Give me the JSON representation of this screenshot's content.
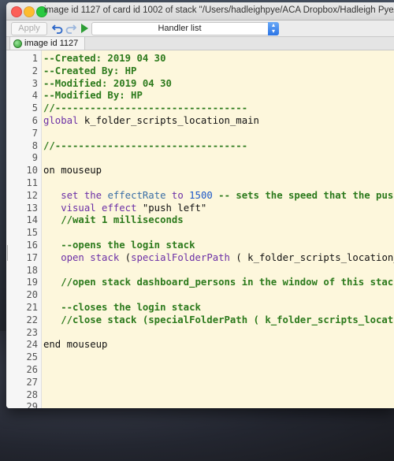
{
  "window": {
    "title": "image id 1127 of card id 1002 of stack \"/Users/hadleighpye/ACA Dropbox/Hadleigh Pye/[_] Beefficient"
  },
  "toolbar": {
    "apply_label": "Apply",
    "undo_icon": "undo-arrow-icon",
    "redo_icon": "redo-arrow-icon",
    "run_icon": "play-icon",
    "handler_select_value": "Handler list"
  },
  "tab": {
    "label": "image id 1127",
    "status_color": "#2e9e2e"
  },
  "colors": {
    "editor_background": "#fdf7dc",
    "comment": "#2c7a1c",
    "command": "#6b2fa6",
    "property": "#3a6ea5",
    "number": "#1a56c8"
  },
  "editor": {
    "lines": [
      {
        "n": "1",
        "segs": [
          {
            "t": "--Created: 2019 04 30",
            "k": "comment"
          }
        ]
      },
      {
        "n": "2",
        "segs": [
          {
            "t": "--Created By: HP",
            "k": "comment"
          }
        ]
      },
      {
        "n": "3",
        "segs": [
          {
            "t": "--Modified: 2019 04 30",
            "k": "comment"
          }
        ]
      },
      {
        "n": "4",
        "segs": [
          {
            "t": "--Modified By: HP",
            "k": "comment"
          }
        ]
      },
      {
        "n": "5",
        "segs": [
          {
            "t": "//---------------------------------",
            "k": "comment"
          }
        ]
      },
      {
        "n": "6",
        "segs": [
          {
            "t": "global",
            "k": "cmd"
          },
          {
            "t": " k_folder_scripts_location_main",
            "k": "pl"
          }
        ]
      },
      {
        "n": "7",
        "segs": []
      },
      {
        "n": "8",
        "segs": [
          {
            "t": "//---------------------------------",
            "k": "comment"
          }
        ]
      },
      {
        "n": "9",
        "segs": []
      },
      {
        "n": "10",
        "segs": [
          {
            "t": "on",
            "k": "kw"
          },
          {
            "t": " mouseup",
            "k": "pl"
          }
        ]
      },
      {
        "n": "11",
        "segs": []
      },
      {
        "n": "12",
        "segs": [
          {
            "t": "   ",
            "k": "pl"
          },
          {
            "t": "set",
            "k": "cmd"
          },
          {
            "t": " ",
            "k": "pl"
          },
          {
            "t": "the",
            "k": "cmd"
          },
          {
            "t": " ",
            "k": "pl"
          },
          {
            "t": "effectRate",
            "k": "prop"
          },
          {
            "t": " ",
            "k": "pl"
          },
          {
            "t": "to",
            "k": "cmd"
          },
          {
            "t": " ",
            "k": "pl"
          },
          {
            "t": "1500",
            "k": "num"
          },
          {
            "t": " -- sets the speed that the push",
            "k": "comment"
          }
        ]
      },
      {
        "n": "13",
        "segs": [
          {
            "t": "   ",
            "k": "pl"
          },
          {
            "t": "visual",
            "k": "cmd"
          },
          {
            "t": " ",
            "k": "pl"
          },
          {
            "t": "effect",
            "k": "cmd"
          },
          {
            "t": " \"push left\"",
            "k": "str"
          }
        ]
      },
      {
        "n": "14",
        "segs": [
          {
            "t": "   //wait 1 milliseconds",
            "k": "comment"
          }
        ]
      },
      {
        "n": "15",
        "segs": []
      },
      {
        "n": "16",
        "segs": [
          {
            "t": "   --opens the login stack",
            "k": "comment"
          }
        ]
      },
      {
        "n": "17",
        "segs": [
          {
            "t": "   ",
            "k": "pl"
          },
          {
            "t": "open",
            "k": "cmd"
          },
          {
            "t": " ",
            "k": "pl"
          },
          {
            "t": "stack",
            "k": "cmd"
          },
          {
            "t": " (",
            "k": "pl"
          },
          {
            "t": "specialFolderPath",
            "k": "cmd"
          },
          {
            "t": " ( k_folder_scripts_location_",
            "k": "pl"
          }
        ]
      },
      {
        "n": "18",
        "segs": []
      },
      {
        "n": "19",
        "segs": [
          {
            "t": "   //open stack dashboard_persons in the window of this stack",
            "k": "comment"
          }
        ]
      },
      {
        "n": "20",
        "segs": []
      },
      {
        "n": "21",
        "segs": [
          {
            "t": "   --closes the login stack",
            "k": "comment"
          }
        ]
      },
      {
        "n": "22",
        "segs": [
          {
            "t": "   //close stack (specialFolderPath ( k_folder_scripts_locatio",
            "k": "comment"
          }
        ]
      },
      {
        "n": "23",
        "segs": []
      },
      {
        "n": "24",
        "segs": [
          {
            "t": "end",
            "k": "kw"
          },
          {
            "t": " mouseup",
            "k": "pl"
          }
        ]
      },
      {
        "n": "25",
        "segs": []
      },
      {
        "n": "26",
        "segs": []
      },
      {
        "n": "27",
        "segs": []
      },
      {
        "n": "28",
        "segs": []
      },
      {
        "n": "29",
        "segs": []
      }
    ]
  }
}
